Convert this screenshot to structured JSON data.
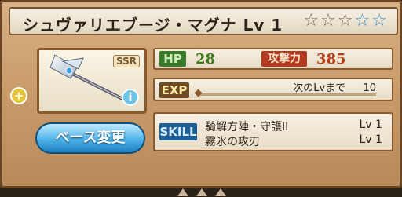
{
  "title": "シュヴァリエブージ・マグナ Lv 1",
  "stars": [
    "empty",
    "empty",
    "empty",
    "blue",
    "blue"
  ],
  "rarity": "SSR",
  "hp": {
    "label": "HP",
    "value": "28"
  },
  "attack": {
    "label": "攻撃力",
    "value": "385"
  },
  "exp": {
    "label": "EXP",
    "next_text": "次のLvまで",
    "next_value": "10",
    "progress": 0.0
  },
  "base_button": {
    "label": "ベース変更"
  },
  "skill": {
    "label": "SKILL",
    "items": [
      {
        "name": "騎解方陣・守護II",
        "level": "Lv 1"
      },
      {
        "name": "霧氷の攻刃",
        "level": "Lv 1"
      }
    ]
  },
  "icons": {
    "plus": "plus-icon",
    "info": "info-icon"
  }
}
